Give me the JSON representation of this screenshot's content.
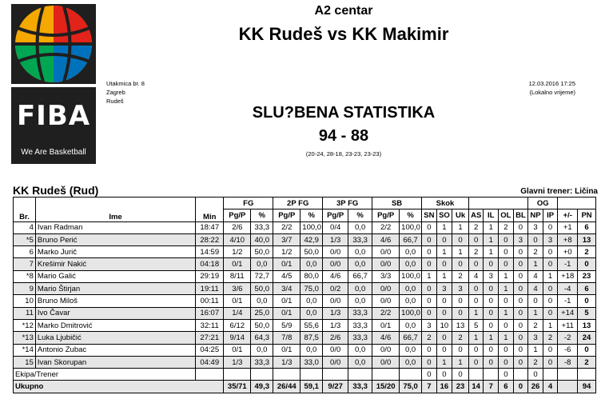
{
  "logo": {
    "brand": "FIBA",
    "tagline": "We Are Basketball"
  },
  "header": {
    "category": "A2 centar",
    "match_title": "KK Rudeš vs KK Makimir",
    "game_no": "Utakmica br. 8",
    "city": "Zagreb",
    "venue": "Rudeš",
    "datetime": "12.03.2016 17:25",
    "timezone_note": "(Lokalno vrijeme)",
    "doc_title": "SLU?BENA STATISTIKA",
    "score": "94 - 88",
    "quarters": "(20-24, 28-18, 23-23, 23-23)"
  },
  "team": {
    "name": "KK Rudeš (Rud)",
    "coach_label": "Glavni trener:",
    "coach_name": "Ličina"
  },
  "columns": {
    "group": {
      "fg": "FG",
      "p2": "2P FG",
      "p3": "3P FG",
      "sb": "SB",
      "skok": "Skok",
      "og": "OG"
    },
    "br": "Br.",
    "ime": "Ime",
    "min": "Min",
    "pgp": "Pg/P",
    "pct": "%",
    "sn": "SN",
    "so": "SO",
    "uk": "Uk",
    "as": "AS",
    "il": "IL",
    "ol": "OL",
    "bl": "BL",
    "np": "NP",
    "ip": "IP",
    "pm": "+/-",
    "pn": "PN"
  },
  "players": [
    {
      "no": "4",
      "name": "Ivan Radman",
      "min": "18:47",
      "fg": "2/6",
      "fgp": "33,3",
      "p2": "2/2",
      "p2p": "100,0",
      "p3": "0/4",
      "p3p": "0,0",
      "sb": "2/2",
      "sbp": "100,0",
      "sn": "0",
      "so": "1",
      "uk": "1",
      "as": "2",
      "il": "1",
      "ol": "2",
      "bl": "0",
      "np": "3",
      "ip": "0",
      "pm": "+1",
      "pn": "6"
    },
    {
      "no": "*5",
      "name": "Bruno Perić",
      "min": "28:22",
      "fg": "4/10",
      "fgp": "40,0",
      "p2": "3/7",
      "p2p": "42,9",
      "p3": "1/3",
      "p3p": "33,3",
      "sb": "4/6",
      "sbp": "66,7",
      "sn": "0",
      "so": "0",
      "uk": "0",
      "as": "0",
      "il": "1",
      "ol": "0",
      "bl": "3",
      "np": "0",
      "ip": "3",
      "pm": "+8",
      "pn": "13"
    },
    {
      "no": "6",
      "name": "Marko Jurič",
      "min": "14:59",
      "fg": "1/2",
      "fgp": "50,0",
      "p2": "1/2",
      "p2p": "50,0",
      "p3": "0/0",
      "p3p": "0,0",
      "sb": "0/0",
      "sbp": "0,0",
      "sn": "0",
      "so": "1",
      "uk": "1",
      "as": "2",
      "il": "1",
      "ol": "0",
      "bl": "0",
      "np": "2",
      "ip": "0",
      "pm": "+0",
      "pn": "2"
    },
    {
      "no": "7",
      "name": "Krešimir Nakić",
      "min": "04:18",
      "fg": "0/1",
      "fgp": "0,0",
      "p2": "0/1",
      "p2p": "0,0",
      "p3": "0/0",
      "p3p": "0,0",
      "sb": "0/0",
      "sbp": "0,0",
      "sn": "0",
      "so": "0",
      "uk": "0",
      "as": "0",
      "il": "0",
      "ol": "0",
      "bl": "0",
      "np": "1",
      "ip": "0",
      "pm": "-1",
      "pn": "0"
    },
    {
      "no": "*8",
      "name": "Mario Galić",
      "min": "29:19",
      "fg": "8/11",
      "fgp": "72,7",
      "p2": "4/5",
      "p2p": "80,0",
      "p3": "4/6",
      "p3p": "66,7",
      "sb": "3/3",
      "sbp": "100,0",
      "sn": "1",
      "so": "1",
      "uk": "2",
      "as": "4",
      "il": "3",
      "ol": "1",
      "bl": "0",
      "np": "4",
      "ip": "1",
      "pm": "+18",
      "pn": "23"
    },
    {
      "no": "9",
      "name": "Mario Štirjan",
      "min": "19:11",
      "fg": "3/6",
      "fgp": "50,0",
      "p2": "3/4",
      "p2p": "75,0",
      "p3": "0/2",
      "p3p": "0,0",
      "sb": "0/0",
      "sbp": "0,0",
      "sn": "0",
      "so": "3",
      "uk": "3",
      "as": "0",
      "il": "0",
      "ol": "1",
      "bl": "0",
      "np": "4",
      "ip": "0",
      "pm": "-4",
      "pn": "6"
    },
    {
      "no": "10",
      "name": "Bruno Miloš",
      "min": "00:11",
      "fg": "0/1",
      "fgp": "0,0",
      "p2": "0/1",
      "p2p": "0,0",
      "p3": "0/0",
      "p3p": "0,0",
      "sb": "0/0",
      "sbp": "0,0",
      "sn": "0",
      "so": "0",
      "uk": "0",
      "as": "0",
      "il": "0",
      "ol": "0",
      "bl": "0",
      "np": "0",
      "ip": "0",
      "pm": "-1",
      "pn": "0"
    },
    {
      "no": "11",
      "name": "Ivo Čavar",
      "min": "16:07",
      "fg": "1/4",
      "fgp": "25,0",
      "p2": "0/1",
      "p2p": "0,0",
      "p3": "1/3",
      "p3p": "33,3",
      "sb": "2/2",
      "sbp": "100,0",
      "sn": "0",
      "so": "0",
      "uk": "0",
      "as": "1",
      "il": "0",
      "ol": "1",
      "bl": "0",
      "np": "1",
      "ip": "0",
      "pm": "+14",
      "pn": "5"
    },
    {
      "no": "*12",
      "name": "Marko Dmitrović",
      "min": "32:11",
      "fg": "6/12",
      "fgp": "50,0",
      "p2": "5/9",
      "p2p": "55,6",
      "p3": "1/3",
      "p3p": "33,3",
      "sb": "0/1",
      "sbp": "0,0",
      "sn": "3",
      "so": "10",
      "uk": "13",
      "as": "5",
      "il": "0",
      "ol": "0",
      "bl": "0",
      "np": "2",
      "ip": "1",
      "pm": "+11",
      "pn": "13"
    },
    {
      "no": "*13",
      "name": "Luka Ljubičić",
      "min": "27:21",
      "fg": "9/14",
      "fgp": "64,3",
      "p2": "7/8",
      "p2p": "87,5",
      "p3": "2/6",
      "p3p": "33,3",
      "sb": "4/6",
      "sbp": "66,7",
      "sn": "2",
      "so": "0",
      "uk": "2",
      "as": "1",
      "il": "1",
      "ol": "1",
      "bl": "0",
      "np": "3",
      "ip": "2",
      "pm": "-2",
      "pn": "24"
    },
    {
      "no": "*14",
      "name": "Antonio Zubac",
      "min": "04:25",
      "fg": "0/1",
      "fgp": "0,0",
      "p2": "0/1",
      "p2p": "0,0",
      "p3": "0/0",
      "p3p": "0,0",
      "sb": "0/0",
      "sbp": "0,0",
      "sn": "0",
      "so": "0",
      "uk": "0",
      "as": "0",
      "il": "0",
      "ol": "0",
      "bl": "0",
      "np": "1",
      "ip": "0",
      "pm": "-6",
      "pn": "0"
    },
    {
      "no": "15",
      "name": "Ivan Skorupan",
      "min": "04:49",
      "fg": "1/3",
      "fgp": "33,3",
      "p2": "1/3",
      "p2p": "33,0",
      "p3": "0/0",
      "p3p": "0,0",
      "sb": "0/0",
      "sbp": "0,0",
      "sn": "0",
      "so": "1",
      "uk": "1",
      "as": "0",
      "il": "0",
      "ol": "0",
      "bl": "0",
      "np": "2",
      "ip": "0",
      "pm": "-8",
      "pn": "2"
    }
  ],
  "team_row": {
    "label": "Ekipa/Trener",
    "sn": "0",
    "so": "0",
    "uk": "0",
    "ol": "0",
    "np": "0"
  },
  "total_row": {
    "label": "Ukupno",
    "fg": "35/71",
    "fgp": "49,3",
    "p2": "26/44",
    "p2p": "59,1",
    "p3": "9/27",
    "p3p": "33,3",
    "sb": "15/20",
    "sbp": "75,0",
    "sn": "7",
    "so": "16",
    "uk": "23",
    "as": "14",
    "il": "7",
    "ol": "6",
    "bl": "0",
    "np": "26",
    "ip": "4",
    "pn": "94"
  }
}
